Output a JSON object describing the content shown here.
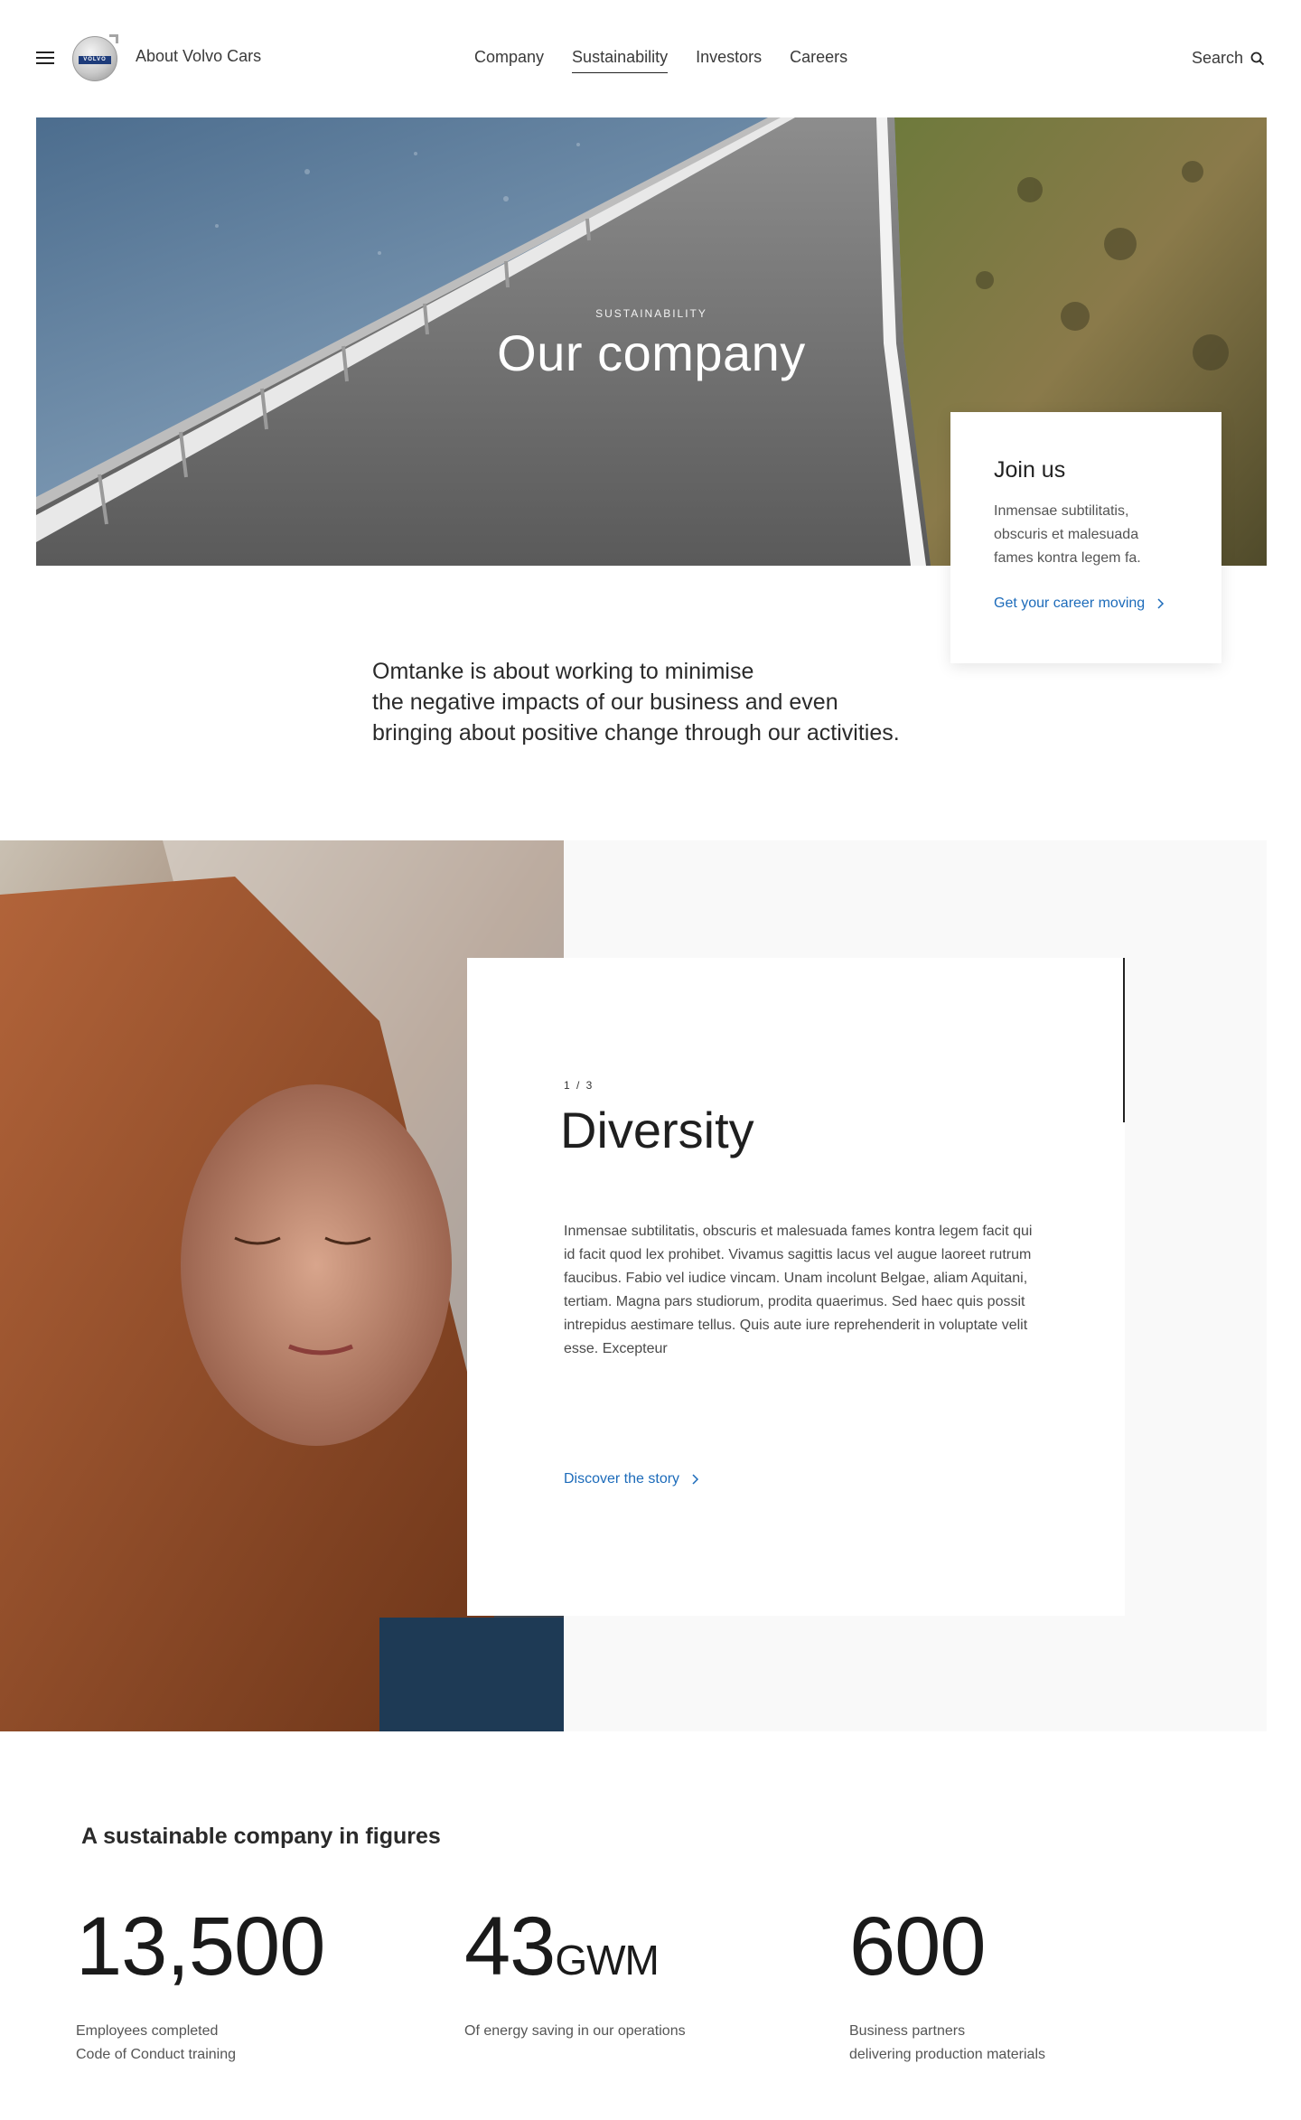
{
  "header": {
    "site_title": "About Volvo Cars",
    "logo_text": "VOLVO",
    "nav": [
      {
        "label": "Company",
        "active": false
      },
      {
        "label": "Sustainability",
        "active": true
      },
      {
        "label": "Investors",
        "active": false
      },
      {
        "label": "Careers",
        "active": false
      }
    ],
    "search_label": "Search",
    "icons": {
      "menu": "hamburger-menu-icon",
      "search": "search-icon"
    }
  },
  "hero": {
    "eyebrow": "SUSTAINABILITY",
    "title": "Our company"
  },
  "join_card": {
    "title": "Join us",
    "text": "Inmensae subtilitatis, obscuris et malesuada fames kontra legem fa.",
    "link_label": "Get your career moving"
  },
  "intro": {
    "lines": [
      "Omtanke is about working to minimise",
      "the negative impacts of our business and even",
      "bringing about positive change through our activities."
    ]
  },
  "feature": {
    "counter": "1 / 3",
    "title": "Diversity",
    "text": "Inmensae subtilitatis, obscuris et malesuada fames kontra legem facit qui id facit quod lex prohibet. Vivamus sagittis lacus vel augue laoreet rutrum faucibus. Fabio vel iudice vincam. Unam incolunt Belgae, aliam Aquitani, tertiam. Magna pars studiorum, prodita quaerimus. Sed haec quis possit intrepidus aestimare tellus. Quis aute iure reprehenderit in voluptate velit esse. Excepteur",
    "link_label": "Discover the story"
  },
  "figures": {
    "title": "A sustainable company in figures",
    "items": [
      {
        "value": "13,500",
        "unit": "",
        "caption": [
          "Employees completed",
          "Code of Conduct training"
        ]
      },
      {
        "value": "43",
        "unit": "GWM",
        "caption": [
          "Of energy saving in our operations"
        ]
      },
      {
        "value": "600",
        "unit": "",
        "caption": [
          "Business partners",
          "delivering production materials"
        ]
      }
    ]
  },
  "colors": {
    "link": "#1c6bba",
    "text": "#1f1f1f",
    "panel_bg": "#f9f9f9"
  }
}
